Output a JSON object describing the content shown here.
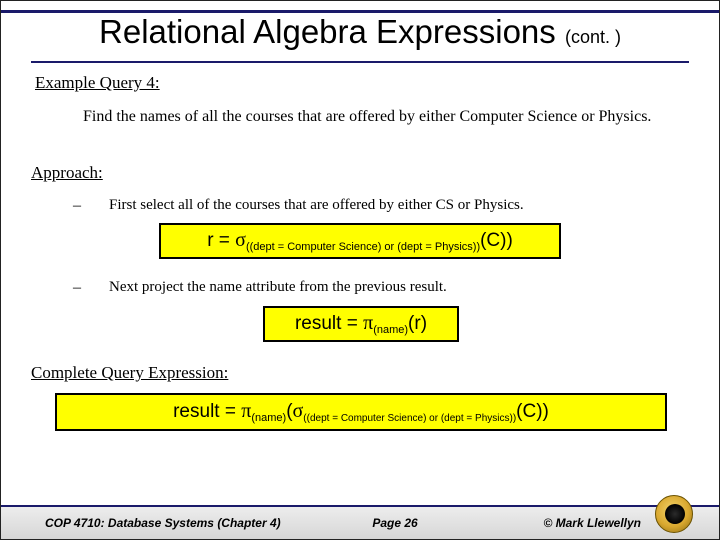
{
  "title": {
    "main": "Relational Algebra Expressions ",
    "cont": "(cont. )"
  },
  "example_label": "Example Query 4:",
  "example_text": "Find the names of all the courses that are offered by either Computer Science or Physics.",
  "approach_label": "Approach:",
  "steps": [
    "First select all of the courses that are offered by either CS or Physics.",
    "Next project the name attribute from the previous result."
  ],
  "formula1": {
    "lhs": "r = ",
    "op": "σ",
    "sub": "((dept = Computer Science) or (dept = Physics))",
    "arg": "(C))"
  },
  "formula2": {
    "lhs": "result = ",
    "op": "π",
    "sub": "(name)",
    "arg": "(r)"
  },
  "complete_label": "Complete Query Expression:",
  "formula3": {
    "lhs": "result = ",
    "op1": "π",
    "sub1": "(name)",
    "open": "(",
    "op2": "σ",
    "sub2": "((dept = Computer Science) or (dept = Physics))",
    "arg": "(C))"
  },
  "footer": {
    "left": "COP 4710: Database Systems  (Chapter 4)",
    "center": "Page 26",
    "right": "© Mark Llewellyn"
  }
}
